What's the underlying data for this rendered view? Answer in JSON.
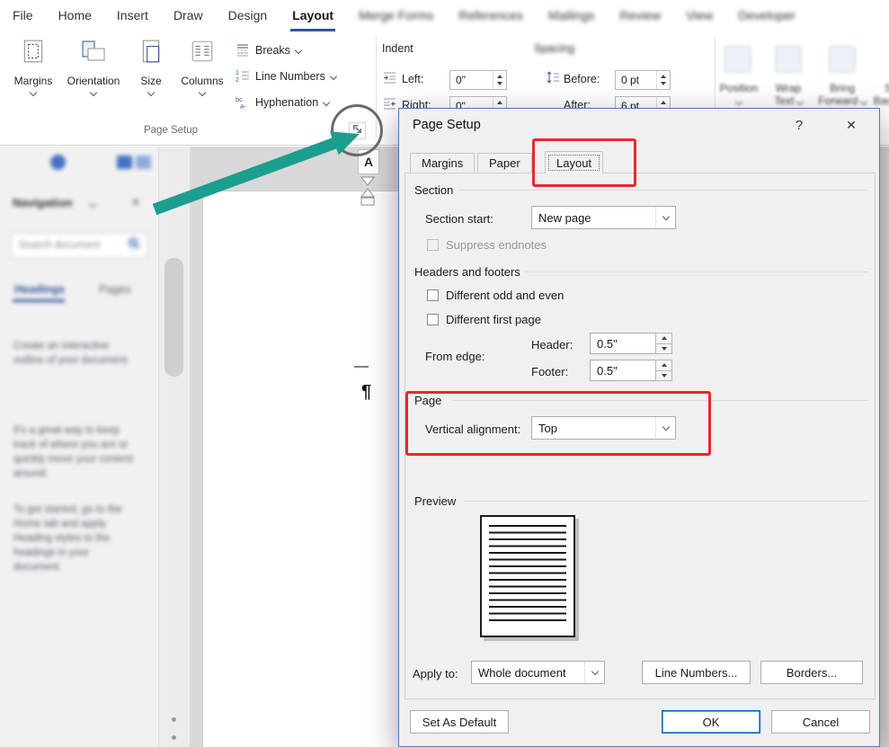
{
  "colors": {
    "accent": "#2b579a",
    "highlight": "#e8272e",
    "arrow": "#1b9e8e"
  },
  "ribbon": {
    "tabs": [
      {
        "label": "File"
      },
      {
        "label": "Home"
      },
      {
        "label": "Insert"
      },
      {
        "label": "Draw"
      },
      {
        "label": "Design"
      },
      {
        "label": "Layout"
      },
      {
        "label": "Merge Forms"
      },
      {
        "label": "References"
      },
      {
        "label": "Mailings"
      },
      {
        "label": "Review"
      },
      {
        "label": "View"
      },
      {
        "label": "Developer"
      }
    ],
    "active_tab": "Layout",
    "page_setup_group": {
      "label": "Page Setup",
      "margins": "Margins",
      "orientation": "Orientation",
      "size": "Size",
      "columns": "Columns",
      "breaks": "Breaks",
      "line_numbers": "Line Numbers",
      "hyphenation": "Hyphenation"
    },
    "paragraph_group": {
      "indent_label": "Indent",
      "spacing_label": "Spacing",
      "left_label": "Left:",
      "left_value": "0\"",
      "right_label": "Right:",
      "right_value": "0\"",
      "before_label": "Before:",
      "before_value": "0 pt",
      "after_label": "After:",
      "after_value": "6 pt"
    },
    "arrange_group": {
      "position": "Position",
      "wrap_line1": "Wrap",
      "wrap_line2": "Text",
      "bring_line1": "Bring",
      "bring_line2": "Forward",
      "send_line1": "Send",
      "send_line2": "Backward"
    }
  },
  "nav_pane": {
    "title": "Navigation",
    "close_glyph": "✕",
    "search_placeholder": "Search document",
    "tab_headings": "Headings",
    "tab_pages": "Pages",
    "paragraphs": [
      "Create an interactive outline of your document.",
      "It's a great way to keep track of where you are or quickly move your content around.",
      "To get started, go to the Home tab and apply Heading styles to the headings in your document."
    ]
  },
  "document": {
    "pilcrow": "¶",
    "tab_selector": "A"
  },
  "dialog": {
    "title": "Page Setup",
    "help_glyph": "?",
    "close_glyph": "✕",
    "tabs": [
      {
        "label": "Margins"
      },
      {
        "label": "Paper"
      },
      {
        "label": "Layout"
      }
    ],
    "active_tab": "Layout",
    "section": {
      "label": "Section",
      "start_label": "Section start:",
      "start_value": "New page",
      "suppress_label": "Suppress endnotes"
    },
    "headers_footers": {
      "label": "Headers and footers",
      "odd_even_label": "Different odd and even",
      "first_page_label": "Different first page",
      "from_edge_label": "From edge:",
      "header_label": "Header:",
      "header_value": "0.5\"",
      "footer_label": "Footer:",
      "footer_value": "0.5\""
    },
    "page": {
      "label": "Page",
      "valign_label": "Vertical alignment:",
      "valign_value": "Top"
    },
    "preview_label": "Preview",
    "apply_label": "Apply to:",
    "apply_value": "Whole document",
    "buttons": {
      "line_numbers": "Line Numbers...",
      "borders": "Borders...",
      "set_default": "Set As Default",
      "ok": "OK",
      "cancel": "Cancel"
    }
  }
}
